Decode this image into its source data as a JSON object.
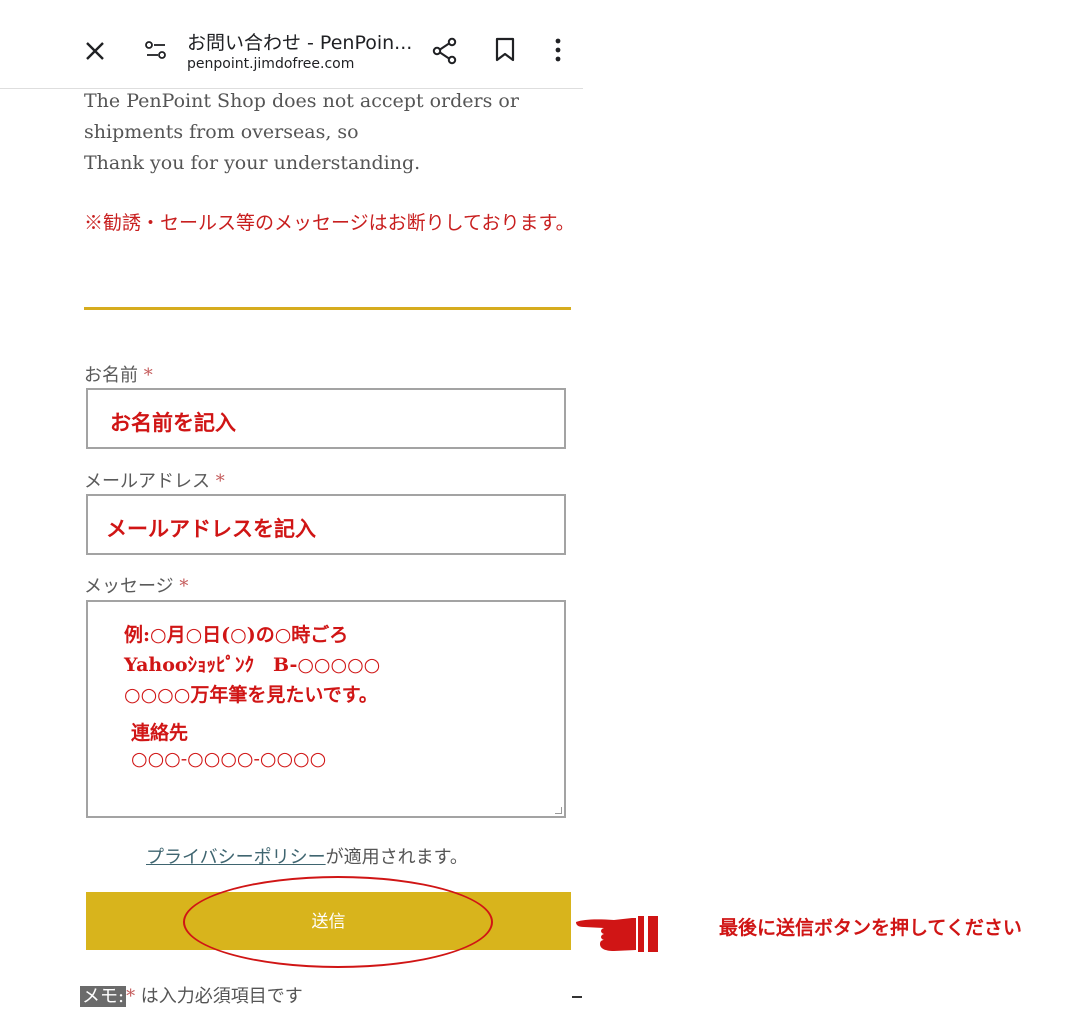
{
  "toolbar": {
    "page_title": "お問い合わせ - PenPoin...",
    "url": "penpoint.jimdofree.com",
    "icons": [
      "close-icon",
      "page-settings-icon",
      "share-icon",
      "bookmark-icon",
      "more-vert-icon"
    ]
  },
  "notice": {
    "lines": [
      "The PenPoint Shop does not accept orders or",
      "shipments from overseas, so",
      "Thank you for your understanding."
    ],
    "warning": "※勧誘・セールス等のメッセージはお断りしております。"
  },
  "form": {
    "name": {
      "label": "お名前",
      "required_mark": "*",
      "value": "お名前を記入"
    },
    "email": {
      "label": "メールアドレス",
      "required_mark": "*",
      "value": "メールアドレスを記入"
    },
    "message": {
      "label": "メッセージ",
      "required_mark": "*",
      "lines": [
        "例:○月○日(○)の○時ごろ",
        "Yahooｼｮｯﾋﾟﾝｸ　B-○○○○○",
        "○○○○万年筆を見たいです。",
        "連絡先",
        "○○○-○○○○-○○○○"
      ]
    },
    "privacy_link": "プライバシーポリシー",
    "privacy_suffix": "が適用されます。",
    "submit_label": "送信",
    "memo_tag": "メモ:",
    "memo_required": "*",
    "memo_text": " は入力必須項目です"
  },
  "annotation": {
    "callout": "最後に送信ボタンを押してください"
  },
  "colors": {
    "accent_gold": "#d8b41c",
    "annotation_red": "#d01515"
  }
}
